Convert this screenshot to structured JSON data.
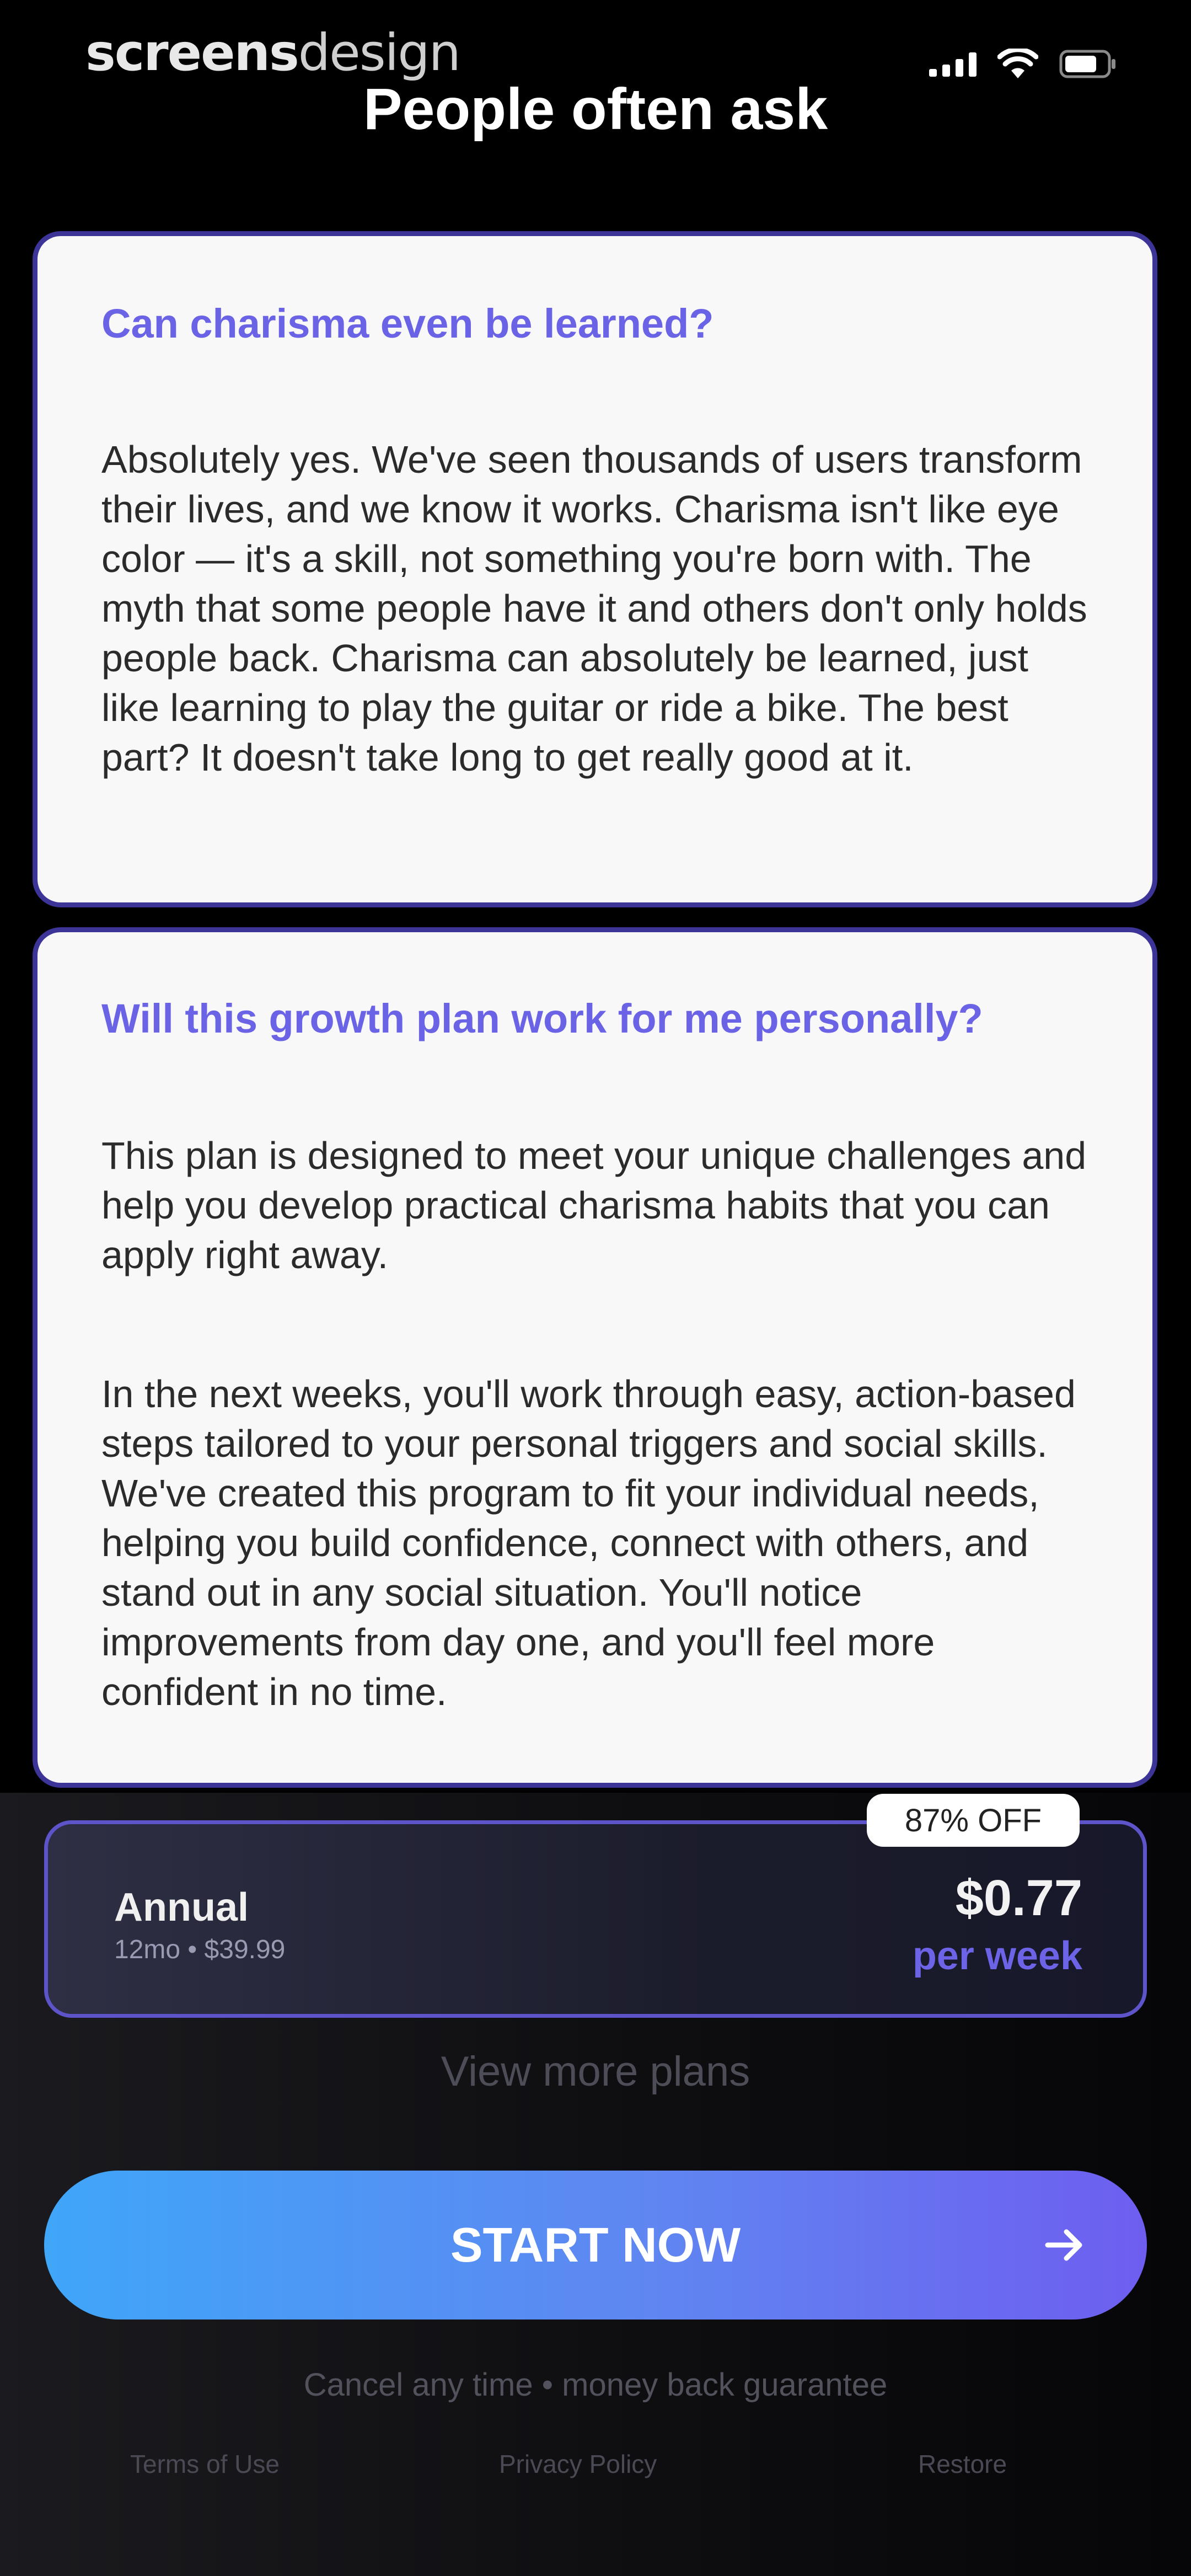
{
  "status_bar": {
    "watermark_bold": "screens",
    "watermark_light": "design",
    "signal_icon": "cellular-signal-icon",
    "wifi_icon": "wifi-icon",
    "battery_icon": "battery-icon"
  },
  "header": {
    "title": "People often ask"
  },
  "faq": [
    {
      "question": "Can charisma even be learned?",
      "answers": [
        "Absolutely yes. We've seen thousands of users transform their lives, and we know it works. Charisma isn't like eye color — it's a skill, not something you're born with. The myth that some people have it and others don't only holds people back. Charisma can absolutely be learned, just like learning to play the guitar or ride a bike. The best part? It doesn't take long to get really good at it."
      ]
    },
    {
      "question": "Will this growth plan work for me personally?",
      "answers": [
        "This plan is designed to meet your unique challenges and help you develop practical charisma habits that you can apply right away.",
        "In the next weeks, you'll work through easy, action-based steps tailored to your personal triggers and social skills. We've created this program to fit your individual needs, helping you build confidence, connect with others, and stand out in any social situation. You'll notice improvements from day one, and you'll feel more confident in no time."
      ]
    }
  ],
  "plan": {
    "name": "Annual",
    "subtitle": "12mo • $39.99",
    "price": "$0.77",
    "unit": "per week",
    "badge": "87% OFF"
  },
  "more_plans": "View more plans",
  "cta": {
    "label": "START NOW",
    "icon": "arrow-right-icon"
  },
  "guarantee": "Cancel any time • money back guarantee",
  "footer": {
    "terms": "Terms of Use",
    "privacy": "Privacy Policy",
    "restore": "Restore"
  },
  "colors": {
    "accent": "#6b63e5",
    "card_border": "#3c3597",
    "cta_start": "#3fa6f8",
    "cta_end": "#6e5ef0"
  }
}
